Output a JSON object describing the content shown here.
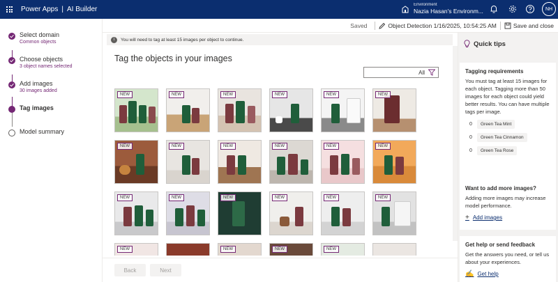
{
  "topbar": {
    "app_name": "Power Apps",
    "section": "AI Builder",
    "env_label": "Environment",
    "env_name": "Nazia Hasan's Environm...",
    "avatar_initials": "NH",
    "bg_color": "#0b2e6f"
  },
  "steps": [
    {
      "title": "Select domain",
      "sub": "Common objects",
      "state": "done"
    },
    {
      "title": "Choose objects",
      "sub": "3 object names selected",
      "state": "done"
    },
    {
      "title": "Add images",
      "sub": "30 images added",
      "state": "done"
    },
    {
      "title": "Tag images",
      "sub": "",
      "state": "active"
    },
    {
      "title": "Model summary",
      "sub": "",
      "state": "pending"
    }
  ],
  "cmdbar": {
    "saved": "Saved",
    "model_name": "Object Detection 1/16/2025, 10:54:25 AM",
    "save_close": "Save and close"
  },
  "warning": "You will need to tag at least 15 images per object to continue.",
  "main": {
    "title": "Tag the objects in your images",
    "filter_value": "All",
    "badge": "NEW"
  },
  "footer": {
    "back": "Back",
    "next": "Next"
  },
  "tips": {
    "heading": "Quick tips",
    "tagging": {
      "title": "Tagging requirements",
      "body": "You must tag at least 15 images for each object. Tagging more than 50 images for each object could yield better results. You can have multiple tags per image.",
      "tags": [
        {
          "count": "0",
          "name": "Green Tea Mint"
        },
        {
          "count": "0",
          "name": "Green Tea Cinnamon"
        },
        {
          "count": "0",
          "name": "Green Tea Rose"
        }
      ]
    },
    "more": {
      "title": "Want to add more images?",
      "body": "Adding more images may increase model performance.",
      "link": "Add images"
    },
    "help": {
      "title": "Get help or send feedback",
      "body": "Get the answers you need, or tell us about your experiences.",
      "link": "Get help"
    }
  },
  "accent": "#742774"
}
